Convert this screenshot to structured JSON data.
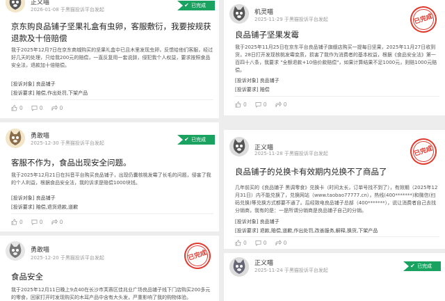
{
  "cards": [
    {
      "user": "正义喵",
      "meta": "2026-01-08 于黑猫投诉平台发起",
      "status": "已完成",
      "title": "京东购良品铺子坚果礼盒有虫卵，客服敷衍，我要按规获退款及十倍赔偿",
      "body": "我于2025年12月7日在京东商城购买的坚果礼盒中已且木里发现虫卵，反馈给他们客服，经过好几天的处理，只给我200元的赔偿，一直反复用一套说辞，侵犯我个人权益，要求按照食品安全法，退款加十倍赔偿。",
      "target": "[投诉对象] 良品铺子",
      "demand": "[投诉要求] 赔偿,作出处罚,下架产品",
      "likes": "0",
      "comments": "0",
      "shares": "0"
    },
    {
      "user": "勇敢喵",
      "meta": "2025-12-30 于黑猫投诉平台发起",
      "status": "已完成",
      "title": "客服不作为，食品出现安全问题。",
      "body": "我于2025年12月21日在抖音平台购买良品铺子，出现仍囊核桃发霉了长毛的问题，侵害了我的个人利益，根据食品安全法，我的诉求是赔偿1000块钱。",
      "target": "[投诉对象] 良品铺子",
      "demand": "[投诉要求] 赔偿,退货退款,道歉",
      "likes": "0",
      "comments": "0",
      "shares": "0"
    },
    {
      "user": "勇敢喵",
      "meta": "2025-12-20 于黑猫投诉平台发起",
      "stamp": "已完成",
      "title": "食品安全",
      "body": "我于2025年12月11日晚上9点40在长沙市芙蓉区佳兆业广场良品铺子线下门店购买200多元的零食，回家打开时发现购买的木耳产品中含有大头发，严重影响了我的购物体验。"
    },
    {
      "user": "机灵喵",
      "meta": "2025-11-29 于黑猫投诉平台发起",
      "stamp": "已完成",
      "title": "良品铺子坚果发霉",
      "body": "我于2025年11月25日在京东平台良品铺子旗舰店购买一提每日坚果，2025年11月27日收到货，28日打开发现核桃发霉变质，损害了我作为消费者的基本权益，根据《食品安全法》第一百四十八条，我要求 \"全额退款+10倍价款赔偿\"，如果计算结果不足1000元，则赔1000元赔偿。",
      "target": "[投诉对象] 良品铺子",
      "demand": "[投诉要求] 赔偿",
      "likes": "0",
      "comments": "0",
      "shares": "0"
    },
    {
      "user": "正义喵",
      "meta": "2025-11-28 于黑猫投诉平台发起",
      "stamp": "已完成",
      "title": "良品铺子的兑换卡有效期内兑换不了商品了",
      "body": "几年前买的《良品铺子 黑调零食》兑换卡（时间太长，订单号找不到了），有效期（2025年12月31日）内不能兑换了，兑换网站（www.taobao77777.cn），热线(400*******)和微信(扫码兑换)等兑换方式都要不通了。后经致电良品铺子总部（400*******），说让消费者自己去找分销商，我有的是：一是所谓分销商是良品铺子自己的分销。",
      "target": "[投诉对象] 良品铺子",
      "demand": "[投诉要求] 退款,赔偿,道歉,作出处罚,改善服务,解释,换货,下架产品",
      "likes": "0",
      "comments": "0",
      "shares": "0"
    },
    {
      "user": "正义喵",
      "meta": "2025-11-24 于黑猫投诉平台发起",
      "status": "已完成"
    }
  ],
  "icons": [
    "cat-avatar-icon",
    "check-icon",
    "thumb-up-icon",
    "comment-icon",
    "share-icon"
  ],
  "colors": {
    "done_green": "#1aa260",
    "stamp_red": "#e03a2f"
  }
}
